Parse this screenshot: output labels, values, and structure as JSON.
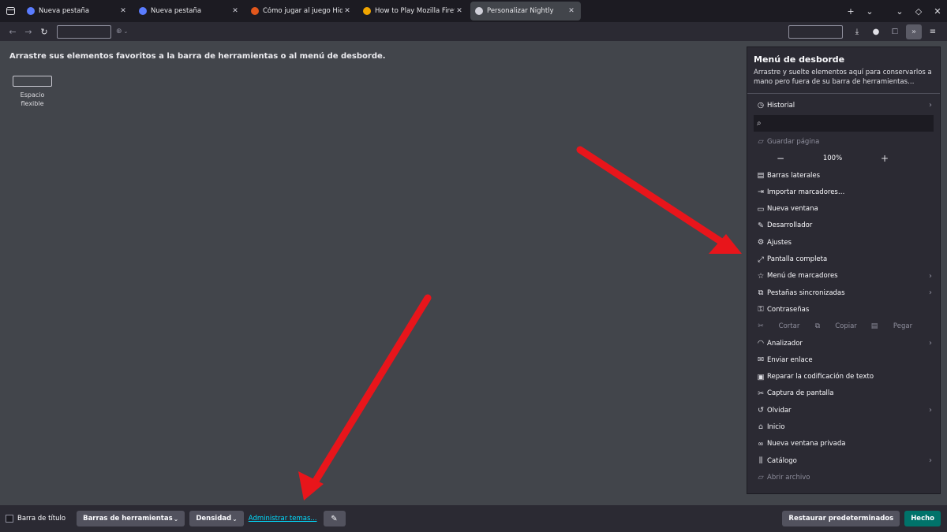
{
  "tabs": [
    {
      "title": "Nueva pestaña",
      "favicon_color": "#5a7cff",
      "active": false
    },
    {
      "title": "Nueva pestaña",
      "favicon_color": "#5a7cff",
      "active": false
    },
    {
      "title": "Cómo jugar al juego Hidden",
      "favicon_color": "#e2571c",
      "active": false
    },
    {
      "title": "How to Play Mozilla Firefox",
      "favicon_color": "#f0a500",
      "active": false
    },
    {
      "title": "Personalizar Nightly",
      "favicon_color": "#cfcfd8",
      "active": true
    }
  ],
  "tabstrip": {
    "new_tab_glyph": "+",
    "list_glyph": "⌄",
    "min_glyph": "⌄",
    "max_glyph": "◇",
    "close_glyph": "✕"
  },
  "main": {
    "heading": "Arrastre sus elementos favoritos a la barra de herramientas o al menú de desborde.",
    "flex_space_label": "Espacio flexible"
  },
  "overflow": {
    "title": "Menú de desborde",
    "description": "Arrastre y suelte elementos aquí para conservarlos a mano pero fuera de su barra de herramientas…",
    "history": "Historial",
    "save_page": "Guardar página",
    "zoom": {
      "minus": "−",
      "value": "100%",
      "plus": "+"
    },
    "items": [
      {
        "label": "Barras laterales",
        "icon": "sidebar-icon",
        "glyph": "▤",
        "chevron": false,
        "disabled": false
      },
      {
        "label": "Importar marcadores…",
        "icon": "import-icon",
        "glyph": "⇥",
        "chevron": false,
        "disabled": false
      },
      {
        "label": "Nueva ventana",
        "icon": "new-window-icon",
        "glyph": "▭",
        "chevron": false,
        "disabled": false
      },
      {
        "label": "Desarrollador",
        "icon": "wrench-icon",
        "glyph": "✎",
        "chevron": false,
        "disabled": false
      },
      {
        "label": "Ajustes",
        "icon": "gear-icon",
        "glyph": "⚙",
        "chevron": false,
        "disabled": false
      },
      {
        "label": "Pantalla completa",
        "icon": "fullscreen-icon",
        "glyph": "⤢",
        "chevron": false,
        "disabled": false
      },
      {
        "label": "Menú de marcadores",
        "icon": "bookmark-star-icon",
        "glyph": "☆",
        "chevron": true,
        "disabled": false
      },
      {
        "label": "Pestañas sincronizadas",
        "icon": "synced-tabs-icon",
        "glyph": "⧉",
        "chevron": true,
        "disabled": false
      },
      {
        "label": "Contraseñas",
        "icon": "key-icon",
        "glyph": "⚿",
        "chevron": false,
        "disabled": false
      }
    ],
    "edit": {
      "cut": "Cortar",
      "copy": "Copiar",
      "paste": "Pegar"
    },
    "items2": [
      {
        "label": "Analizador",
        "icon": "profiler-icon",
        "glyph": "◠",
        "chevron": true,
        "disabled": false
      },
      {
        "label": "Enviar enlace",
        "icon": "mail-icon",
        "glyph": "✉",
        "chevron": false,
        "disabled": false
      },
      {
        "label": "Reparar la codificación de texto",
        "icon": "text-encoding-icon",
        "glyph": "▣",
        "chevron": false,
        "disabled": false
      },
      {
        "label": "Captura de pantalla",
        "icon": "screenshot-icon",
        "glyph": "✂",
        "chevron": false,
        "disabled": false
      },
      {
        "label": "Olvidar",
        "icon": "forget-icon",
        "glyph": "↺",
        "chevron": true,
        "disabled": false
      },
      {
        "label": "Inicio",
        "icon": "home-icon",
        "glyph": "⌂",
        "chevron": false,
        "disabled": false
      },
      {
        "label": "Nueva ventana privada",
        "icon": "private-mask-icon",
        "glyph": "∞",
        "chevron": false,
        "disabled": false
      },
      {
        "label": "Catálogo",
        "icon": "library-icon",
        "glyph": "⫼",
        "chevron": true,
        "disabled": false
      },
      {
        "label": "Abrir archivo",
        "icon": "folder-open-icon",
        "glyph": "▱",
        "chevron": false,
        "disabled": true
      }
    ]
  },
  "footer": {
    "title_bar_label": "Barra de título",
    "toolbars_label": "Barras de herramientas",
    "density_label": "Densidad",
    "manage_themes_label": "Administrar temas...",
    "restore_label": "Restaurar predeterminados",
    "done_label": "Hecho"
  },
  "colors": {
    "annotation_arrow": "#e8151b",
    "accent_done": "#00736a"
  }
}
